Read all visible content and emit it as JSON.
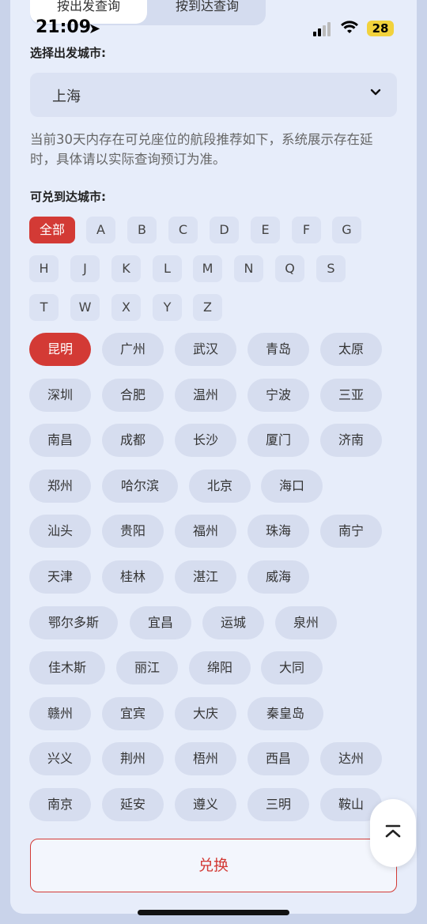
{
  "tabs": {
    "departure": "按出发查询",
    "arrival": "按到达查询"
  },
  "status": {
    "time": "21:09",
    "battery": "28"
  },
  "departure": {
    "label": "选择出发城市:",
    "value": "上海"
  },
  "note": "当前30天内存在可兑座位的航段推荐如下，系统展示存在延时，具体请以实际查询预订为准。",
  "arrival_label": "可兑到达城市:",
  "letters": [
    "全部",
    "A",
    "B",
    "C",
    "D",
    "E",
    "F",
    "G",
    "H",
    "J",
    "K",
    "L",
    "M",
    "N",
    "Q",
    "S",
    "T",
    "W",
    "X",
    "Y",
    "Z"
  ],
  "cities": [
    "昆明",
    "广州",
    "武汉",
    "青岛",
    "太原",
    "深圳",
    "合肥",
    "温州",
    "宁波",
    "三亚",
    "南昌",
    "成都",
    "长沙",
    "厦门",
    "济南",
    "郑州",
    "哈尔滨",
    "北京",
    "海口",
    "汕头",
    "贵阳",
    "福州",
    "珠海",
    "南宁",
    "天津",
    "桂林",
    "湛江",
    "威海",
    "鄂尔多斯",
    "宜昌",
    "运城",
    "泉州",
    "佳木斯",
    "丽江",
    "绵阳",
    "大同",
    "赣州",
    "宜宾",
    "大庆",
    "秦皇岛",
    "兴义",
    "荆州",
    "梧州",
    "西昌",
    "达州",
    "南京",
    "延安",
    "遵义",
    "三明",
    "鞍山"
  ],
  "redeem_button": "兑换",
  "colors": {
    "accent": "#d33a35",
    "panel": "#e7edfa",
    "chip": "#d6ddef"
  }
}
